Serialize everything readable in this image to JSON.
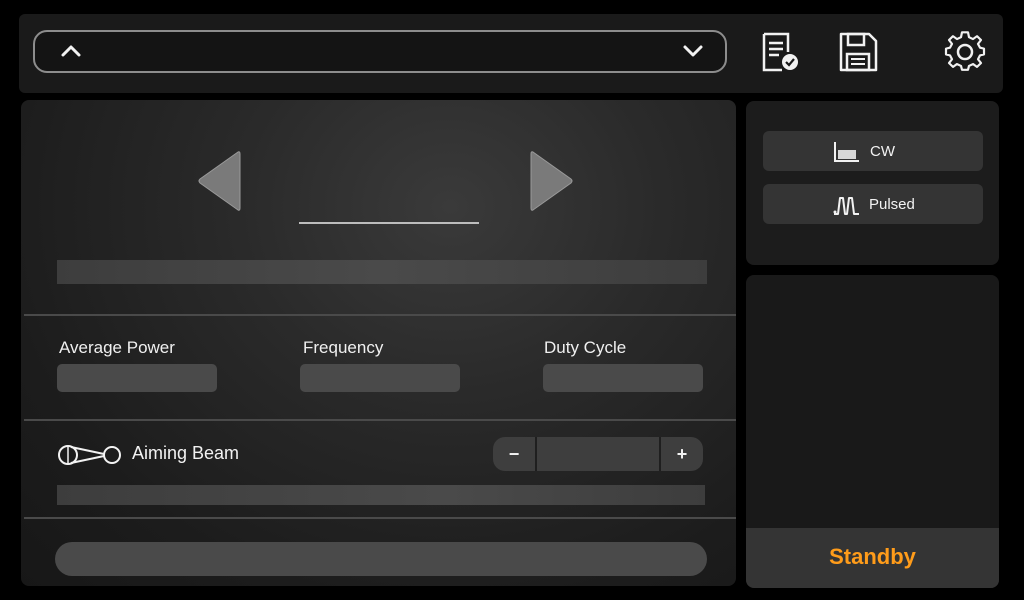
{
  "topbar": {
    "selector_value": "",
    "icons": {
      "up": "chevron-up-icon",
      "down": "chevron-down-icon",
      "report": "report-check-icon",
      "save": "floppy-disk-icon",
      "settings": "gear-icon"
    }
  },
  "main": {
    "mode_value": "",
    "params": [
      {
        "label": "Average Power",
        "value": ""
      },
      {
        "label": "Frequency",
        "value": ""
      },
      {
        "label": "Duty Cycle",
        "value": ""
      }
    ],
    "aiming": {
      "label": "Aiming Beam",
      "minus_label": "−",
      "plus_label": "+",
      "value": ""
    }
  },
  "mode_panel": {
    "cw_label": "CW",
    "pulsed_label": "Pulsed"
  },
  "status": {
    "text": "Standby",
    "color": "#ff9c1a"
  },
  "colors": {
    "background": "#000000",
    "panel": "#1a1a1a",
    "button": "#343434",
    "field": "#4a4a4a",
    "status_accent": "#ff9c1a"
  }
}
